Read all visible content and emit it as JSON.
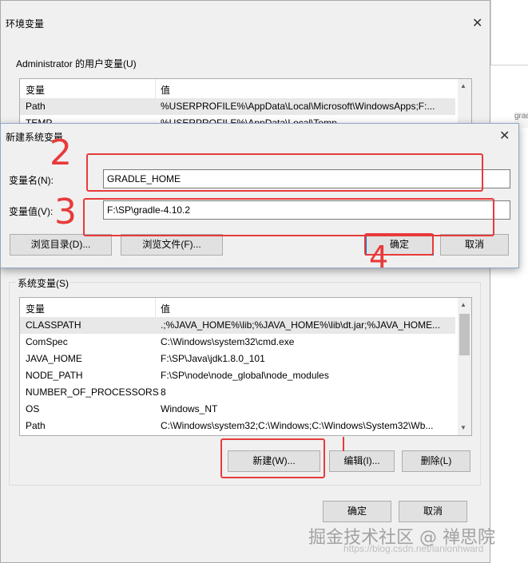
{
  "env_window": {
    "title": "环境变量",
    "close_glyph": "✕",
    "user_group_label": "Administrator 的用户变量(U)",
    "user_list": {
      "columns": [
        "变量",
        "值"
      ],
      "rows": [
        {
          "name": "Path",
          "value": "%USERPROFILE%\\AppData\\Local\\Microsoft\\WindowsApps;F:..."
        },
        {
          "name": "TEMP",
          "value": "%USERPROFILE%\\AppData\\Local\\Temp"
        }
      ]
    },
    "sys_group_label": "系统变量(S)",
    "sys_list": {
      "columns": [
        "变量",
        "值"
      ],
      "rows": [
        {
          "name": "CLASSPATH",
          "value": ".;%JAVA_HOME%\\lib;%JAVA_HOME%\\lib\\dt.jar;%JAVA_HOME..."
        },
        {
          "name": "ComSpec",
          "value": "C:\\Windows\\system32\\cmd.exe"
        },
        {
          "name": "JAVA_HOME",
          "value": "F:\\SP\\Java\\jdk1.8.0_101"
        },
        {
          "name": "NODE_PATH",
          "value": "F:\\SP\\node\\node_global\\node_modules"
        },
        {
          "name": "NUMBER_OF_PROCESSORS",
          "value": "8"
        },
        {
          "name": "OS",
          "value": "Windows_NT"
        },
        {
          "name": "Path",
          "value": "C:\\Windows\\system32;C:\\Windows;C:\\Windows\\System32\\Wb..."
        }
      ]
    },
    "sys_buttons": {
      "new": "新建(W)...",
      "edit": "编辑(I)...",
      "delete": "删除(L)"
    },
    "ok": "确定",
    "cancel": "取消"
  },
  "dialog": {
    "title": "新建系统变量",
    "close_glyph": "✕",
    "name_label": "变量名(N):",
    "name_value": "GRADLE_HOME",
    "value_label": "变量值(V):",
    "value_value": "F:\\SP\\gradle-4.10.2",
    "browse_dir": "浏览目录(D)...",
    "browse_file": "浏览文件(F)...",
    "ok": "确定",
    "cancel": "取消"
  },
  "annotations": {
    "step2": "2",
    "step3": "3",
    "step4": "4",
    "color": "#e83a3a"
  },
  "background": {
    "peek_text": "gradle"
  },
  "watermark": {
    "main": "掘金技术社区 @ 禅思院",
    "url": "https://blog.csdn.net/lanlonhward"
  }
}
